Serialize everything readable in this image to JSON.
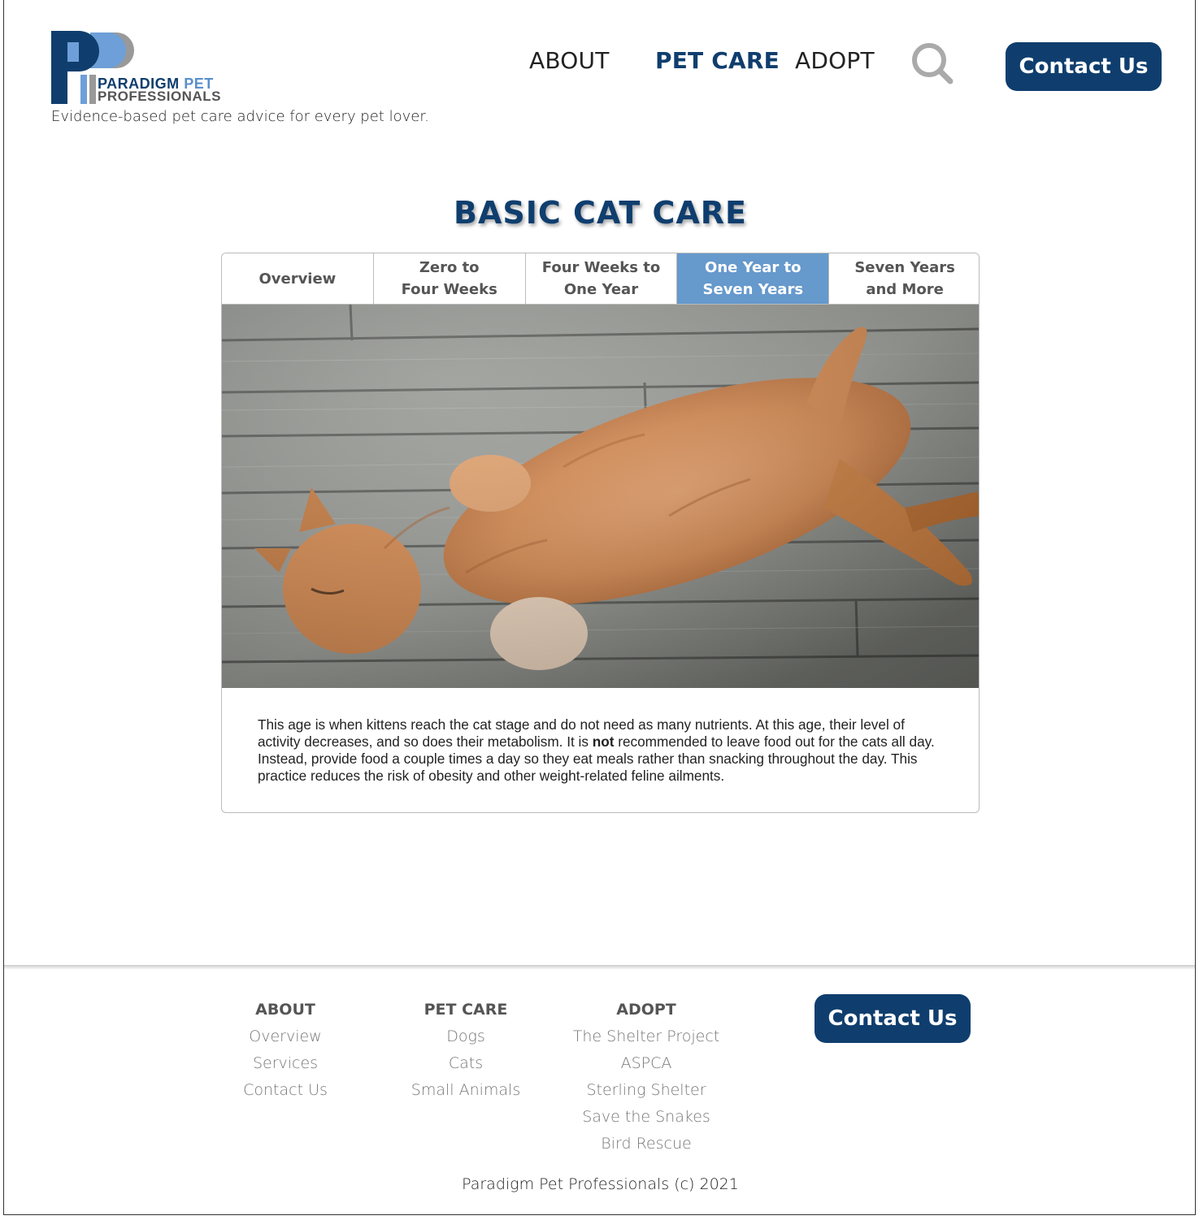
{
  "brand": {
    "logo_line1_a": "PARADIGM",
    "logo_line1_b": "PET",
    "logo_line2": "PROFESSIONALS",
    "tagline": "Evidence-based pet care advice for every pet lover.",
    "primary_color": "#0f3e6e",
    "accent_color": "#6699cc"
  },
  "nav": {
    "items": [
      {
        "label": "ABOUT",
        "active": false
      },
      {
        "label": "PET CARE",
        "active": true
      },
      {
        "label": "ADOPT",
        "active": false
      }
    ],
    "search_icon": "search-icon",
    "contact_label": "Contact Us"
  },
  "page": {
    "title": "BASIC CAT CARE",
    "tabs": [
      {
        "label": "Overview",
        "active": false
      },
      {
        "label": "Zero to\nFour Weeks",
        "active": false
      },
      {
        "label": "Four Weeks to\nOne Year",
        "active": false
      },
      {
        "label": "One Year to\nSeven Years",
        "active": true
      },
      {
        "label": "Seven Years\nand More",
        "active": false
      }
    ],
    "body": {
      "part1": "This age is when kittens reach the cat stage and do not need as many nutrients. At this age, their level of activity decreases, and so does their metabolism. It is ",
      "emphasis": "not",
      "part2": " recommended to leave food out for the cats all day. Instead, provide food a couple times a day so they eat meals rather than snacking throughout the day. This practice reduces the risk of obesity and other weight-related feline ailments."
    }
  },
  "footer": {
    "columns": [
      {
        "heading": "ABOUT",
        "links": [
          "Overview",
          "Services",
          "Contact Us"
        ]
      },
      {
        "heading": "PET CARE",
        "links": [
          "Dogs",
          "Cats",
          "Small Animals"
        ]
      },
      {
        "heading": "ADOPT",
        "links": [
          "The Shelter Project",
          "ASPCA",
          "Sterling Shelter",
          "Save the Snakes",
          "Bird Rescue"
        ]
      }
    ],
    "contact_label": "Contact Us",
    "copyright": "Paradigm Pet Professionals (c) 2021"
  }
}
